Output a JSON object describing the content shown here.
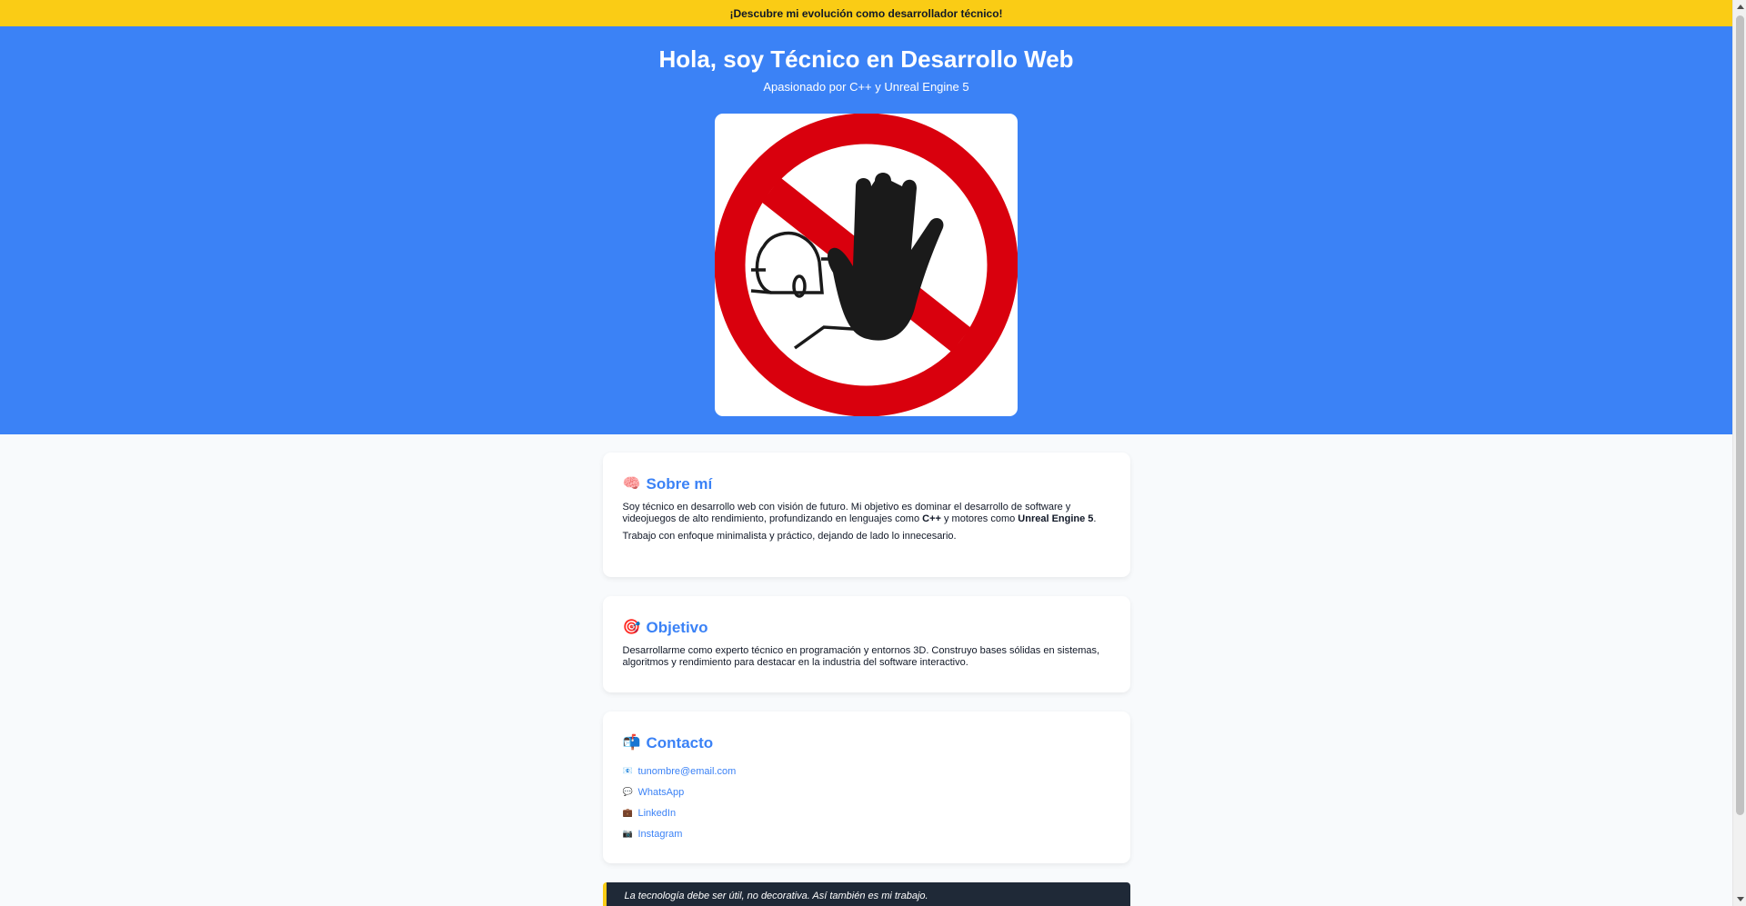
{
  "banner": {
    "text": "¡Descubre mi evolución como desarrollador técnico!"
  },
  "hero": {
    "title": "Hola, soy Técnico en Desarrollo Web",
    "subtitle": "Apasionado por C++ y Unreal Engine 5",
    "image_icon": "no-entry-stop-hand-icon"
  },
  "about": {
    "emoji": "🧠",
    "title": "Sobre mí",
    "p1_a": "Soy técnico en desarrollo web con visión de futuro. Mi objetivo es dominar el desarrollo de software y videojuegos de alto rendimiento, profundizando en lenguajes como ",
    "p1_cpp": "C++",
    "p1_b": " y motores como ",
    "p1_ue": "Unreal Engine 5",
    "p1_c": ".",
    "p2": "Trabajo con enfoque minimalista y práctico, dejando de lado lo innecesario."
  },
  "goal": {
    "emoji": "🎯",
    "title": "Objetivo",
    "text": "Desarrollarme como experto técnico en programación y entornos 3D. Construyo bases sólidas en sistemas, algoritmos y rendimiento para destacar en la industria del software interactivo."
  },
  "contact": {
    "emoji": "📬",
    "title": "Contacto",
    "items": [
      {
        "icon": "📧",
        "label": "tunombre@email.com"
      },
      {
        "icon": "💬",
        "label": "WhatsApp"
      },
      {
        "icon": "💼",
        "label": "LinkedIn"
      },
      {
        "icon": "📷",
        "label": "Instagram"
      }
    ]
  },
  "quote": {
    "text": "La tecnología debe ser útil, no decorativa. Así también es mi trabajo."
  },
  "colors": {
    "accent": "#3b82f6",
    "banner": "#facc15",
    "dark": "#1f2937",
    "sign_red": "#d9000d"
  }
}
